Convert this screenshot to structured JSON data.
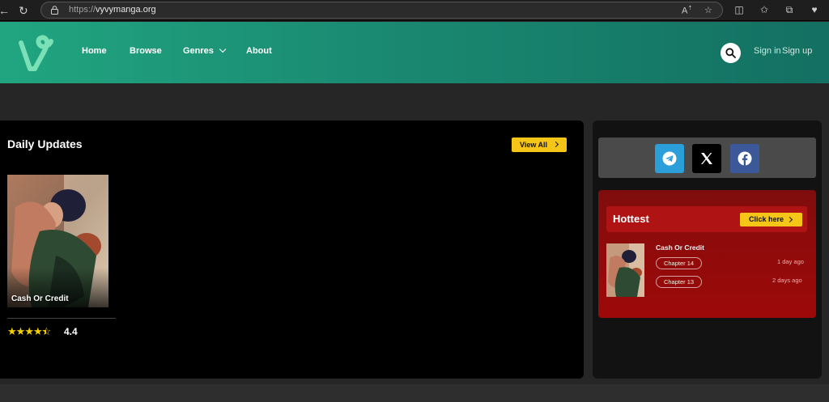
{
  "browser": {
    "url_scheme": "https://",
    "url_host": "vyvymanga.org",
    "reader_icon": "reader-mode-icon",
    "favorite_icon": "star-icon"
  },
  "header": {
    "nav": [
      "Home",
      "Browse",
      "Genres",
      "About"
    ],
    "sign_in": "Sign in",
    "sign_up": "Sign up",
    "brand_color": "#1a8a72"
  },
  "daily": {
    "title": "Daily Updates",
    "view_all": "View All",
    "card": {
      "title": "Cash Or Credit",
      "rating": "4.4",
      "stars": 4.5
    }
  },
  "social": {
    "items": [
      "telegram-icon",
      "x-icon",
      "facebook-icon"
    ]
  },
  "hottest": {
    "title": "Hottest",
    "click_here": "Click here",
    "item": {
      "name": "Cash Or Credit",
      "chapters": [
        {
          "label": "Chapter 14",
          "ago": "1 day ago"
        },
        {
          "label": "Chapter 13",
          "ago": "2 days ago"
        }
      ]
    }
  }
}
